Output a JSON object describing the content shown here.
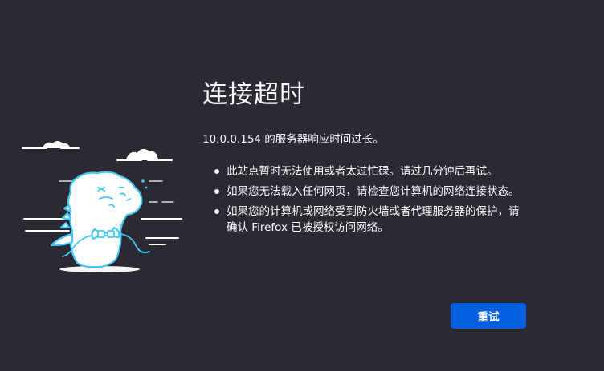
{
  "error": {
    "title": "连接超时",
    "description": "10.0.0.154 的服务器响应时间过长。",
    "tips": [
      "此站点暂时无法使用或者太过忙碌。请过几分钟后再试。",
      "如果您无法载入任何网页，请检查您计算机的网络连接状态。",
      "如果您的计算机或网络受到防火墙或者代理服务器的保护，请确认 Firefox 已被授权访问网络。"
    ],
    "retry_label": "重试"
  },
  "colors": {
    "background": "#2b2a33",
    "text": "#fbfbfe",
    "button": "#0060df",
    "illustration_outline": "#45c8f5"
  },
  "icons": {
    "illustration": "dino-unplugged-cable-illustration"
  }
}
